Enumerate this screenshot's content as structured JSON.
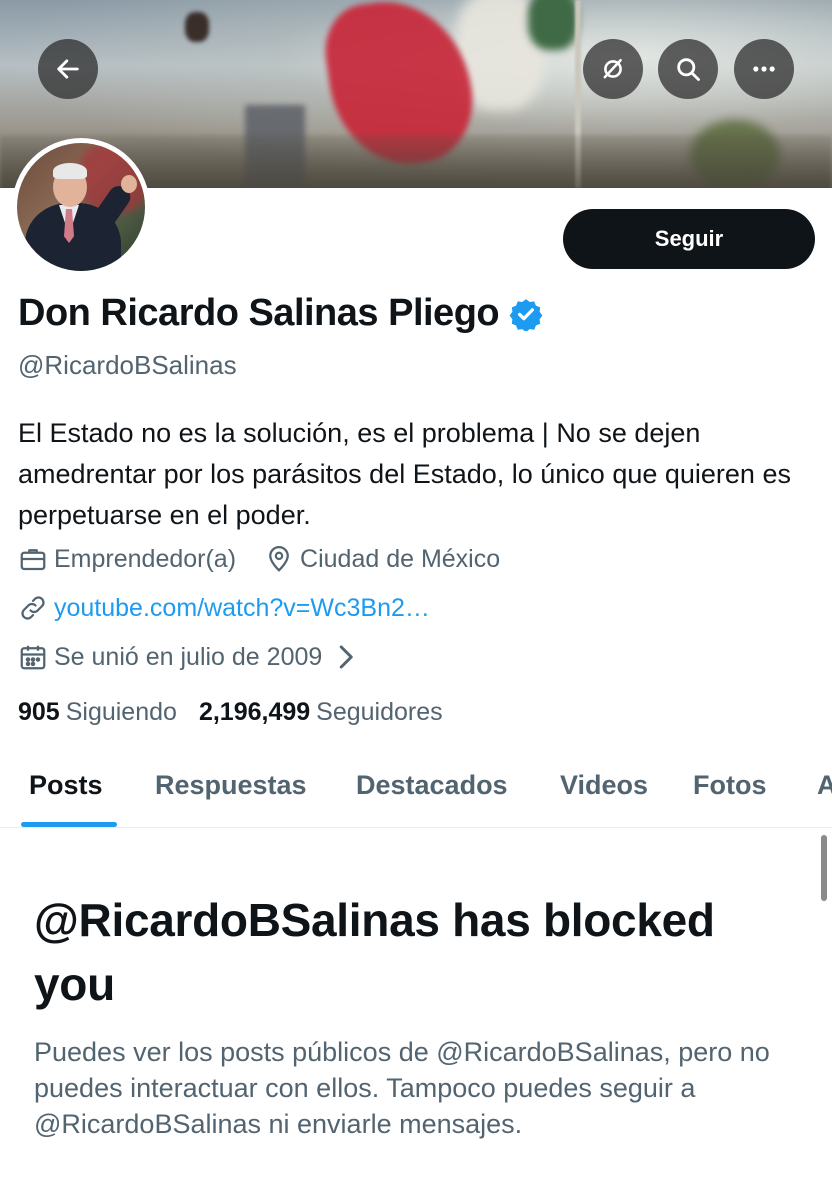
{
  "header": {
    "buttons": {
      "back": "back-arrow-icon",
      "grok": "grok-icon",
      "search": "search-icon",
      "more": "more-icon"
    }
  },
  "profile": {
    "follow_label": "Seguir",
    "name": "Don Ricardo Salinas Pliego",
    "handle": "@RicardoBSalinas",
    "bio": "El Estado no es la solución, es el problema | No se dejen amedrentar por los parásitos del Estado, lo único que quieren es perpetuarse en el poder.",
    "category": "Emprendedor(a)",
    "location": "Ciudad de México",
    "website": "youtube.com/watch?v=Wc3Bn2…",
    "joined": "Se unió en julio de 2009",
    "following_count": "905",
    "following_label": "Siguiendo",
    "followers_count": "2,196,499",
    "followers_label": "Seguidores"
  },
  "tabs": [
    {
      "label": "Posts",
      "active": true
    },
    {
      "label": "Respuestas"
    },
    {
      "label": "Destacados"
    },
    {
      "label": "Videos"
    },
    {
      "label": "Fotos"
    },
    {
      "label": "A"
    }
  ],
  "blocked": {
    "title": "@RicardoBSalinas has blocked you",
    "message": "Puedes ver los posts públicos de @RicardoBSalinas, pero no puedes interactuar con ellos. Tampoco puedes seguir a @RicardoBSalinas ni enviarle mensajes."
  },
  "colors": {
    "accent": "#1d9bf0",
    "text_primary": "#0f1419",
    "text_secondary": "#536471",
    "follow_button_bg": "#0f1419"
  }
}
